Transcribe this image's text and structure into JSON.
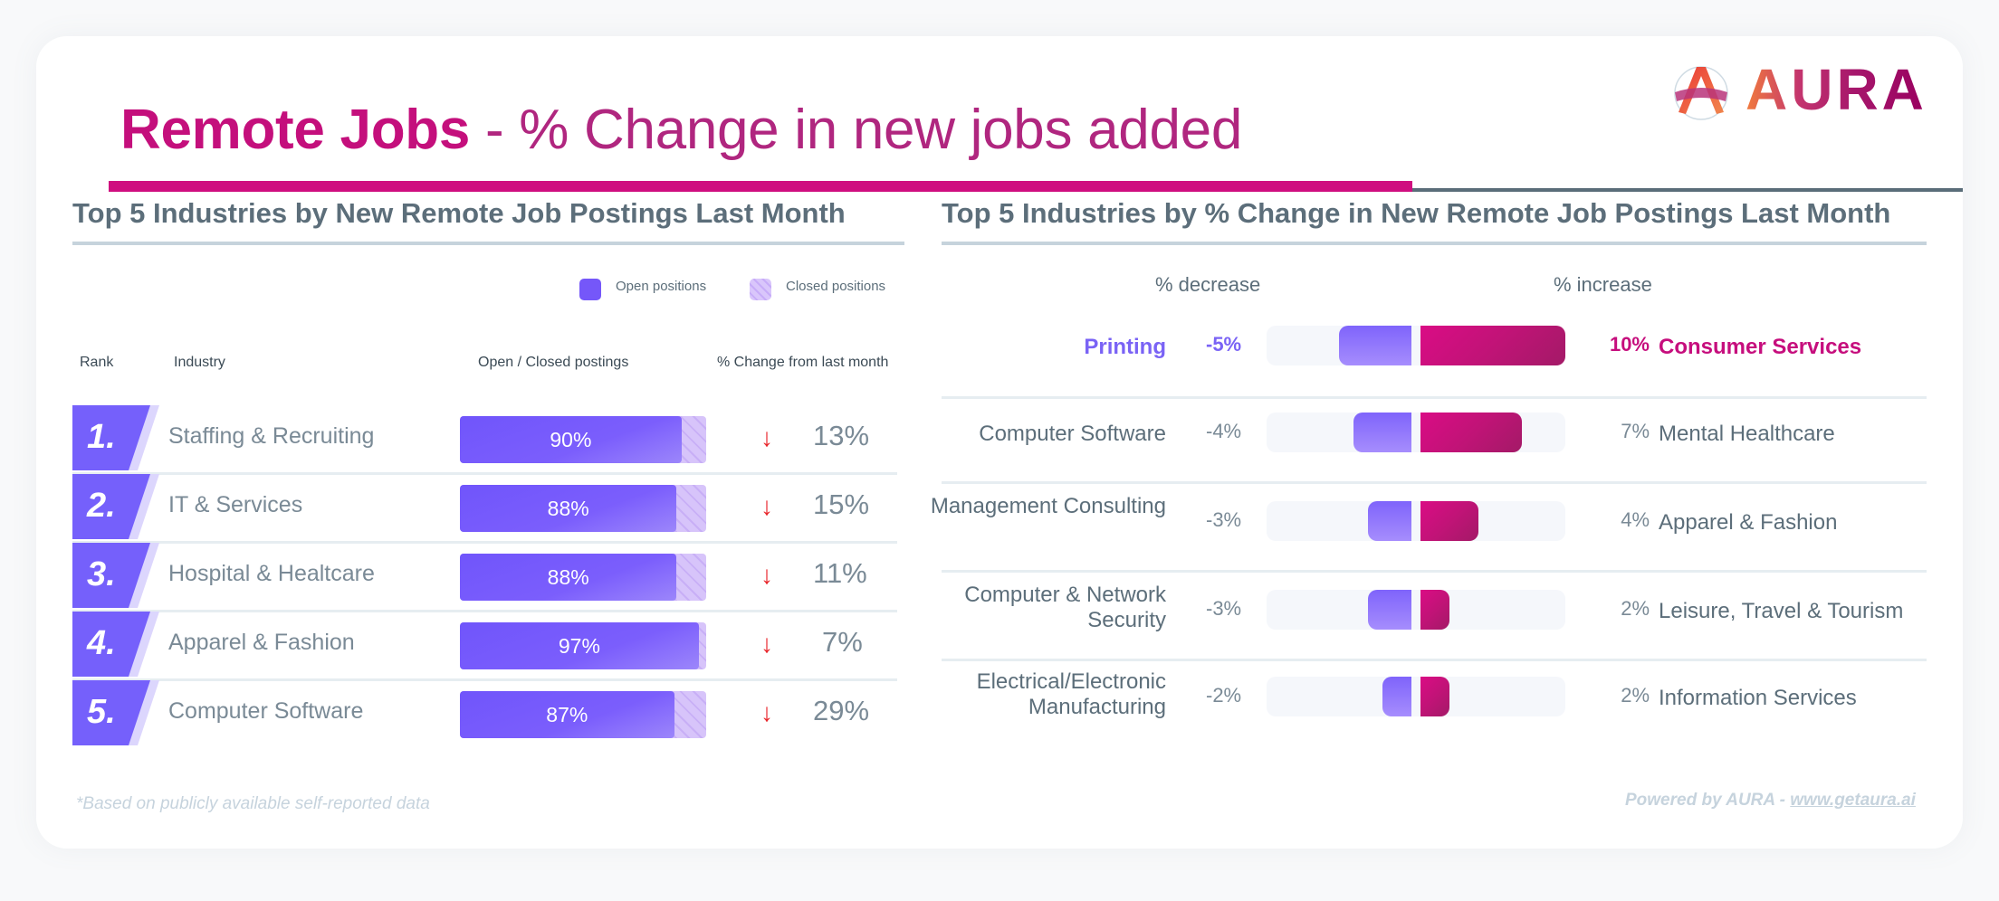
{
  "header": {
    "title_bold": "Remote Jobs",
    "title_rest": " - % Change in new jobs added",
    "logo_text": "AURA",
    "logo_icon": "aura-logo-icon"
  },
  "colors": {
    "brand_magenta": "#cf0e7f",
    "open_purple": "#7557f9",
    "closed_lavender": "#d7c4fa",
    "decrease_arrow": "#e8262b",
    "increase_magenta": "#c60e7d",
    "decrease_purple": "#7a63f5"
  },
  "chart_data": [
    {
      "type": "bar",
      "title": "Top 5 Industries by New Remote Job Postings Last Month",
      "legend": [
        "Open positions",
        "Closed positions"
      ],
      "legend_position": "top-right",
      "columns": [
        "Rank",
        "Industry",
        "Open / Closed postings",
        "% Change from last month"
      ],
      "rows": [
        {
          "rank": "1.",
          "industry": "Staffing & Recruiting",
          "open_pct": 90,
          "open_label": "90%",
          "change_direction": "down",
          "change_label": "13%"
        },
        {
          "rank": "2.",
          "industry": "IT & Services",
          "open_pct": 88,
          "open_label": "88%",
          "change_direction": "down",
          "change_label": "15%"
        },
        {
          "rank": "3.",
          "industry": "Hospital & Healtcare",
          "open_pct": 88,
          "open_label": "88%",
          "change_direction": "down",
          "change_label": "11%"
        },
        {
          "rank": "4.",
          "industry": "Apparel & Fashion",
          "open_pct": 97,
          "open_label": "97%",
          "change_direction": "down",
          "change_label": "7%"
        },
        {
          "rank": "5.",
          "industry": "Computer Software",
          "open_pct": 87,
          "open_label": "87%",
          "change_direction": "down",
          "change_label": "29%"
        }
      ]
    },
    {
      "type": "bar",
      "title": "Top 5 Industries by % Change in New Remote Job Postings Last Month",
      "left_header": "% decrease",
      "right_header": "% increase",
      "xlim": [
        -10,
        10
      ],
      "rows": [
        {
          "decrease_industry": "Printing",
          "decrease_value": -5,
          "decrease_label": "-5%",
          "increase_value": 10,
          "increase_label": "10%",
          "increase_industry": "Consumer Services",
          "highlight": true
        },
        {
          "decrease_industry": "Computer Software",
          "decrease_value": -4,
          "decrease_label": "-4%",
          "increase_value": 7,
          "increase_label": "7%",
          "increase_industry": "Mental Healthcare",
          "highlight": false
        },
        {
          "decrease_industry": "Management Consulting",
          "decrease_value": -3,
          "decrease_label": "-3%",
          "increase_value": 4,
          "increase_label": "4%",
          "increase_industry": "Apparel & Fashion",
          "highlight": false
        },
        {
          "decrease_industry": "Computer & Network Security",
          "decrease_value": -3,
          "decrease_label": "-3%",
          "increase_value": 2,
          "increase_label": "2%",
          "increase_industry": "Leisure, Travel & Tourism",
          "highlight": false
        },
        {
          "decrease_industry": "Electrical/Electronic Manufacturing",
          "decrease_value": -2,
          "decrease_label": "-2%",
          "increase_value": 2,
          "increase_label": "2%",
          "increase_industry": "Information Services",
          "highlight": false
        }
      ]
    }
  ],
  "left": {
    "legend_open": "Open positions",
    "legend_closed": "Closed positions",
    "col_rank": "Rank",
    "col_industry": "Industry",
    "col_bars": "Open / Closed postings",
    "col_change": "% Change from last month"
  },
  "footer": {
    "note": "*Based on publicly available self-reported data",
    "powered_prefix": "Powered by AURA - ",
    "powered_link": "www.getaura.ai"
  }
}
